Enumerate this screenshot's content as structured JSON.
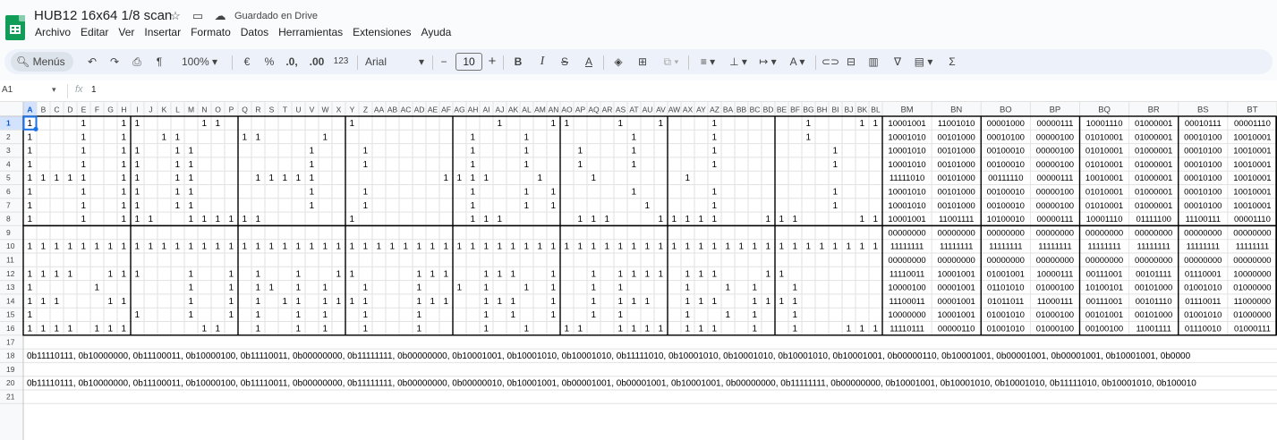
{
  "window": {
    "title": "HUB12 16x64 1/8 scan",
    "save_status": "Guardado en Drive"
  },
  "icons": {
    "logo": "sheets-logo",
    "star": "star-icon",
    "move": "folder-move-icon",
    "cloud": "cloud-saved-icon"
  },
  "menu": [
    "Archivo",
    "Editar",
    "Ver",
    "Insertar",
    "Formato",
    "Datos",
    "Herramientas",
    "Extensiones",
    "Ayuda"
  ],
  "toolbar": {
    "menus": "Menús",
    "zoom": "100%",
    "currency": "€",
    "percent": "%",
    "dec_down": ".0,",
    "dec_up": ".00",
    "number_format": "123",
    "font": "Arial",
    "font_size": "10",
    "bold": "B",
    "italic": "I",
    "strike": "S",
    "text_color": "A"
  },
  "formula_bar": {
    "cell_ref": "A1",
    "fx": "fx",
    "value": "1"
  },
  "grid": {
    "columns": [
      "A",
      "B",
      "C",
      "D",
      "E",
      "F",
      "G",
      "H",
      "I",
      "J",
      "K",
      "L",
      "M",
      "N",
      "O",
      "P",
      "Q",
      "R",
      "S",
      "T",
      "U",
      "V",
      "W",
      "X",
      "Y",
      "Z",
      "AA",
      "AB",
      "AC",
      "AD",
      "AE",
      "AF",
      "AG",
      "AH",
      "AI",
      "AJ",
      "AK",
      "AL",
      "AM",
      "AN",
      "AO",
      "AP",
      "AQ",
      "AR",
      "AS",
      "AT",
      "AU",
      "AV",
      "AW",
      "AX",
      "AY",
      "AZ",
      "BA",
      "BB",
      "BC",
      "BD",
      "BE",
      "BF",
      "BG",
      "BH",
      "BI",
      "BJ",
      "BK",
      "BL",
      "BM",
      "BN",
      "BO",
      "BP",
      "BQ",
      "BR",
      "BS",
      "BT"
    ],
    "rows": [
      "1",
      "2",
      "3",
      "4",
      "5",
      "6",
      "7",
      "8",
      "9",
      "10",
      "11",
      "12",
      "13",
      "14",
      "15",
      "16",
      "17",
      "18",
      "19",
      "20",
      "21"
    ],
    "bits": [
      "1000100110000110000000001000000000010001100010010001000000100011110001110001000110001011110011100001110",
      "1000100100110000110000100000000001000100000001000001000000100000001110000001000000101001000001000100001000001",
      "1000100110011000000001000100000001000100010001000001000000001000000000001100101000010000000000000000000000001",
      "10001001100110000000010001000000010001000100010000010000000010000000000011000000000000000000000000000000001",
      "1111100110011000011111000000000111100010001000000100000000000000000000000000000000000000000000000000000001",
      "1000100110011000000001000100000001000101000001000001000000001000000000011000100000000000000000000000000001",
      "1000100110011000000001000100000001000101000000100001000000001000000000001100110000000000000000000000000001",
      "1000100111001111110000001000000001110000011100011111000111000011100000000000000000000000000000000000000011"
    ],
    "right_cols": [
      "BM",
      "BN",
      "BO",
      "BP",
      "BQ",
      "BR",
      "BS",
      "BT"
    ],
    "right_rows": [
      [
        "10001001",
        "11001010",
        "00001000",
        "00000111",
        "10001110",
        "01000001",
        "00010111",
        "00001110"
      ],
      [
        "10001010",
        "00101000",
        "00010100",
        "00000100",
        "01010001",
        "01000001",
        "00010100",
        "10010001"
      ],
      [
        "10001010",
        "00101000",
        "00100010",
        "00000100",
        "01010001",
        "01000001",
        "00010100",
        "10010001"
      ],
      [
        "10001010",
        "00101000",
        "00100010",
        "00000100",
        "01010001",
        "01000001",
        "00010100",
        "10010001"
      ],
      [
        "11111010",
        "00101000",
        "00111110",
        "00000111",
        "10010001",
        "01000001",
        "00010100",
        "10010001"
      ],
      [
        "10001010",
        "00101000",
        "00100010",
        "00000100",
        "01010001",
        "01000001",
        "00010100",
        "10010001"
      ],
      [
        "10001010",
        "00101000",
        "00100010",
        "00000100",
        "01010001",
        "01000001",
        "00010100",
        "10010001"
      ],
      [
        "10001001",
        "11001111",
        "10100010",
        "00000111",
        "10001110",
        "01111100",
        "11100111",
        "00001110"
      ],
      [
        "00000000",
        "00000000",
        "00000000",
        "00000000",
        "00000000",
        "00000000",
        "00000000",
        "00000000"
      ],
      [
        "11111111",
        "11111111",
        "11111111",
        "11111111",
        "11111111",
        "11111111",
        "11111111",
        "11111111"
      ],
      [
        "00000000",
        "00000000",
        "00000000",
        "00000000",
        "00000000",
        "00000000",
        "00000000",
        "00000000"
      ],
      [
        "11110011",
        "10001001",
        "01001001",
        "10000111",
        "00111001",
        "00101111",
        "01110001",
        "10000000"
      ],
      [
        "10000100",
        "00001001",
        "01101010",
        "01000100",
        "10100101",
        "00101000",
        "01001010",
        "01000000"
      ],
      [
        "11100011",
        "00001001",
        "01011011",
        "11000111",
        "00111001",
        "00101110",
        "01110011",
        "11000000"
      ],
      [
        "10000000",
        "10001001",
        "01001010",
        "01000100",
        "00101001",
        "00101000",
        "01001010",
        "01000000"
      ],
      [
        "11110111",
        "00000110",
        "01001010",
        "01000100",
        "00100100",
        "11001111",
        "01110010",
        "01000111"
      ]
    ],
    "row18": "0b11110111, 0b10000000, 0b11100011, 0b10000100, 0b11110011, 0b00000000, 0b11111111, 0b00000000, 0b10001001, 0b10001010, 0b10001010, 0b11111010, 0b10001010, 0b10001010, 0b10001010, 0b10001001, 0b00000110, 0b10001001, 0b00001001, 0b00001001, 0b10001001, 0b0000",
    "row20": "0b11110111, 0b10000000, 0b11100011, 0b10000100, 0b11110011, 0b00000000, 0b11111111, 0b00000000, 0b00000010, 0b10001001, 0b00001001, 0b00001001, 0b10001001, 0b00000000, 0b11111111, 0b00000000, 0b10001001, 0b10001010, 0b10001010, 0b11111010, 0b10001010, 0b100010"
  }
}
